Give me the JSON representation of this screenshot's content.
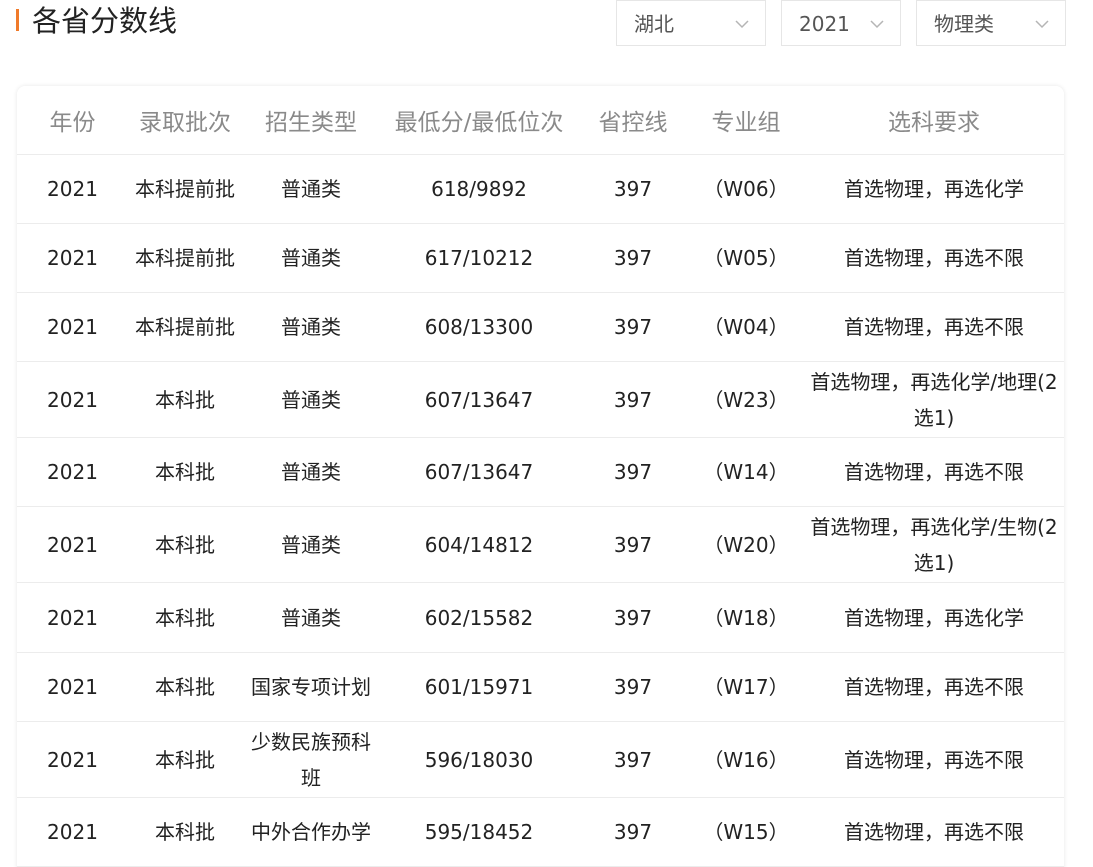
{
  "header": {
    "title": "各省分数线",
    "accent_color": "#f07a2a"
  },
  "filters": {
    "province": "湖北",
    "year": "2021",
    "subject": "物理类"
  },
  "table": {
    "columns": [
      "年份",
      "录取批次",
      "招生类型",
      "最低分/最低位次",
      "省控线",
      "专业组",
      "选科要求"
    ],
    "rows": [
      {
        "year": "2021",
        "batch": "本科提前批",
        "type": "普通类",
        "score": "618/9892",
        "line": "397",
        "group": "（W06）",
        "req": "首选物理，再选化学"
      },
      {
        "year": "2021",
        "batch": "本科提前批",
        "type": "普通类",
        "score": "617/10212",
        "line": "397",
        "group": "（W05）",
        "req": "首选物理，再选不限"
      },
      {
        "year": "2021",
        "batch": "本科提前批",
        "type": "普通类",
        "score": "608/13300",
        "line": "397",
        "group": "（W04）",
        "req": "首选物理，再选不限"
      },
      {
        "year": "2021",
        "batch": "本科批",
        "type": "普通类",
        "score": "607/13647",
        "line": "397",
        "group": "（W23）",
        "req": "首选物理，再选化学/地理(2选1)"
      },
      {
        "year": "2021",
        "batch": "本科批",
        "type": "普通类",
        "score": "607/13647",
        "line": "397",
        "group": "（W14）",
        "req": "首选物理，再选不限"
      },
      {
        "year": "2021",
        "batch": "本科批",
        "type": "普通类",
        "score": "604/14812",
        "line": "397",
        "group": "（W20）",
        "req": "首选物理，再选化学/生物(2选1)"
      },
      {
        "year": "2021",
        "batch": "本科批",
        "type": "普通类",
        "score": "602/15582",
        "line": "397",
        "group": "（W18）",
        "req": "首选物理，再选化学"
      },
      {
        "year": "2021",
        "batch": "本科批",
        "type": "国家专项计划",
        "score": "601/15971",
        "line": "397",
        "group": "（W17）",
        "req": "首选物理，再选不限"
      },
      {
        "year": "2021",
        "batch": "本科批",
        "type": "少数民族预科班",
        "score": "596/18030",
        "line": "397",
        "group": "（W16）",
        "req": "首选物理，再选不限"
      },
      {
        "year": "2021",
        "batch": "本科批",
        "type": "中外合作办学",
        "score": "595/18452",
        "line": "397",
        "group": "（W15）",
        "req": "首选物理，再选不限"
      }
    ]
  },
  "icons": {
    "select_chevron": "chevron-down-icon"
  }
}
